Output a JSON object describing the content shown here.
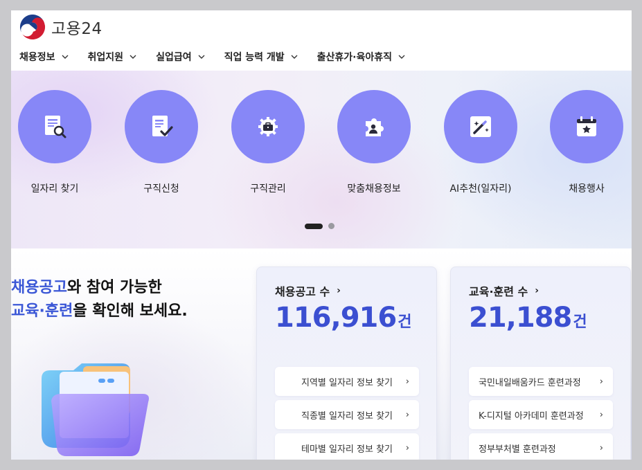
{
  "header": {
    "logo_text": "고용24",
    "nav": [
      {
        "label": "채용정보"
      },
      {
        "label": "취업지원"
      },
      {
        "label": "실업급여"
      },
      {
        "label": "직업 능력 개발"
      },
      {
        "label": "출산휴가·육아휴직"
      }
    ]
  },
  "quick_menu": {
    "items": [
      {
        "label": "일자리 찾기",
        "icon": "document-search-icon"
      },
      {
        "label": "구직신청",
        "icon": "checklist-icon"
      },
      {
        "label": "구직관리",
        "icon": "briefcase-gear-icon"
      },
      {
        "label": "맞춤채용정보",
        "icon": "puzzle-person-icon"
      },
      {
        "label": "AI추천(일자리)",
        "icon": "magic-wand-icon"
      },
      {
        "label": "채용행사",
        "icon": "calendar-star-icon"
      }
    ],
    "pagination": {
      "current": 1,
      "total": 2
    }
  },
  "promo": {
    "line1_accent": "채용공고",
    "line1_rest": "와 참여 가능한",
    "line2_accent": "교육·훈련",
    "line2_rest": "을 확인해 보세요."
  },
  "job_card": {
    "title": "채용공고 수",
    "count": "116,916",
    "unit": "건",
    "links": [
      "지역별 일자리 정보 찾기",
      "직종별 일자리 정보 찾기",
      "테마별 일자리 정보 찾기"
    ]
  },
  "training_card": {
    "title": "교육·훈련 수",
    "count": "21,188",
    "unit": "건",
    "links": [
      "국민내일배움카드 훈련과정",
      "K-디지털 아카데미 훈련과정",
      "정부부처별 훈련과정"
    ]
  },
  "colors": {
    "accent": "#3b4fd1",
    "menu_circle": "#8787f7"
  }
}
